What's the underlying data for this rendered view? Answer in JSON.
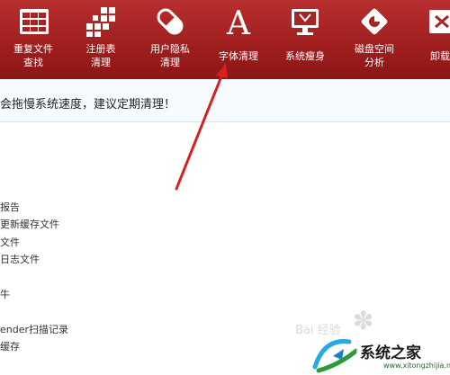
{
  "toolbar": {
    "items": [
      {
        "label": "重复文件\n查找",
        "icon": "grid-icon"
      },
      {
        "label": "注册表\n清理",
        "icon": "registry-blocks-icon"
      },
      {
        "label": "用户隐私\n清理",
        "icon": "privacy-pill-icon"
      },
      {
        "label": "字体清理",
        "icon": "font-a-icon"
      },
      {
        "label": "系统瘦身",
        "icon": "monitor-icon"
      },
      {
        "label": "磁盘空间\n分析",
        "icon": "disk-analysis-icon"
      },
      {
        "label": "卸载",
        "icon": "uninstall-icon"
      }
    ],
    "colors": {
      "bar": "#a52424",
      "icon": "#ffffff"
    }
  },
  "notice": {
    "text": "会拖慢系统速度，建议定期清理！"
  },
  "list": [
    "报告",
    "更新缓存文件",
    "文件",
    "日志文件",
    "牛",
    "ender扫描记录",
    "缓存"
  ],
  "annotation": {
    "color": "#d42020"
  },
  "watermark": {
    "faint_text": "Bai  经验",
    "brand": "系统之家",
    "url": "www.xitongzhijia.net"
  }
}
